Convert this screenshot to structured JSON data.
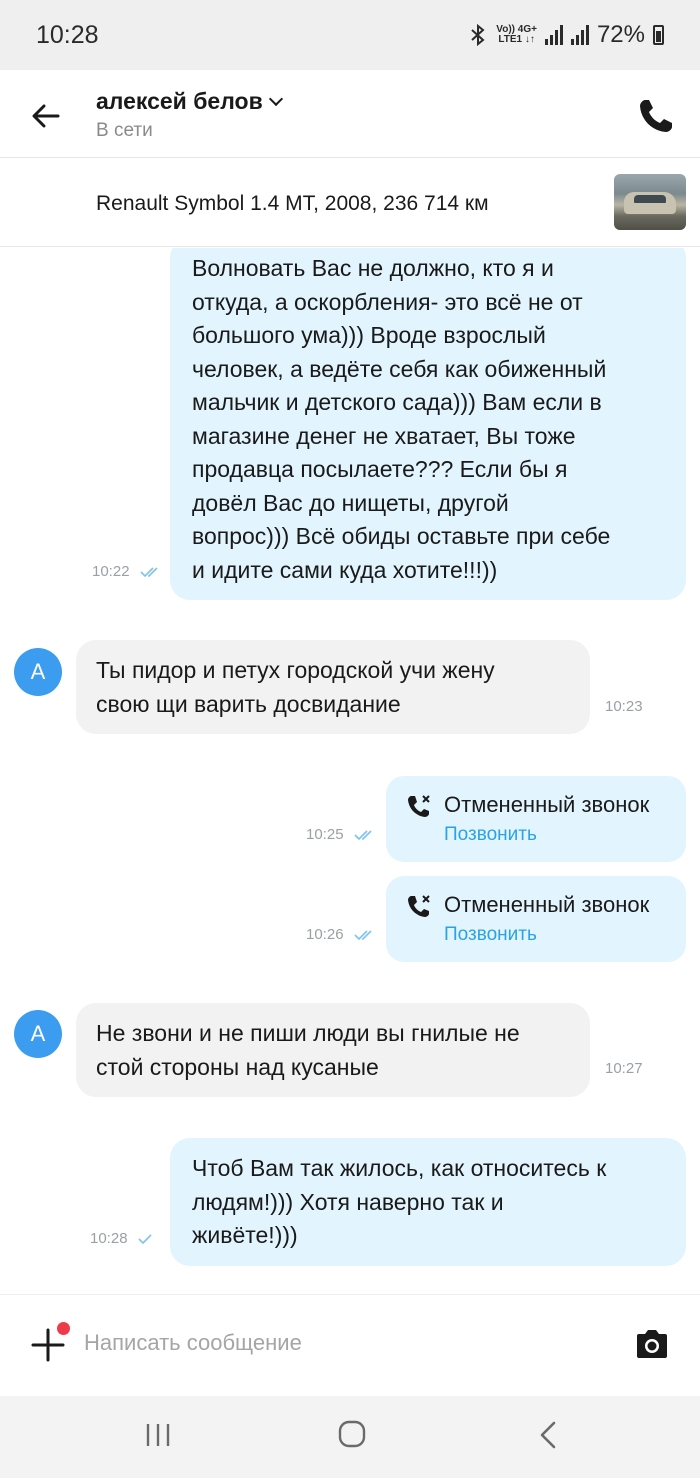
{
  "status_bar": {
    "time": "10:28",
    "net_top": "Vo)) 4G+",
    "net_bottom": "LTE1 ↓↑",
    "battery": "72%"
  },
  "header": {
    "name": "алексей белов",
    "status": "В сети",
    "back_icon": "arrow-left-icon",
    "call_icon": "phone-icon"
  },
  "listing": {
    "title": "Renault Symbol 1.4 MT, 2008, 236 714 км"
  },
  "messages": [
    {
      "side": "out",
      "text": "Волновать Вас не должно,  кто я и\nоткуда,  а оскорбления- это всё не от\nбольшого ума))) Вроде взрослый\nчеловек,  а ведёте себя как обиженный\nмальчик и детского сада))) Вам если в\nмагазине денег не хватает,  Вы тоже\nпродавца посылаете??? Если бы я\nдовёл Вас до нищеты,  другой\nвопрос))) Всё обиды оставьте при себе\nи идите сами куда хотите!!!))",
      "time": "10:22",
      "read": true
    },
    {
      "side": "in",
      "avatar": "А",
      "text": "Ты пидор и петух городской учи жену\nсвою щи варить досвидание",
      "time": "10:23"
    },
    {
      "side": "call",
      "label": "Отмененный звонок",
      "action": "Позвонить",
      "time": "10:25",
      "read": true
    },
    {
      "side": "call",
      "label": "Отмененный звонок",
      "action": "Позвонить",
      "time": "10:26",
      "read": true
    },
    {
      "side": "in",
      "avatar": "А",
      "text": "Не  звони и не пиши люди вы гнилые не\nстой стороны над кусаные",
      "time": "10:27"
    },
    {
      "side": "out",
      "text": "Чтоб Вам так жилось,  как относитесь к\nлюдям!))) Хотя наверно так и\nживёте!)))",
      "time": "10:28",
      "read": false
    }
  ],
  "composer": {
    "placeholder": "Написать сообщение",
    "value": ""
  },
  "colors": {
    "out_bubble": "#e2f4fd",
    "in_bubble": "#f2f2f3",
    "avatar": "#3b9cf0",
    "link": "#2aa3e6",
    "check": "#7ec3ec",
    "notification_dot": "#ee3b4a"
  }
}
